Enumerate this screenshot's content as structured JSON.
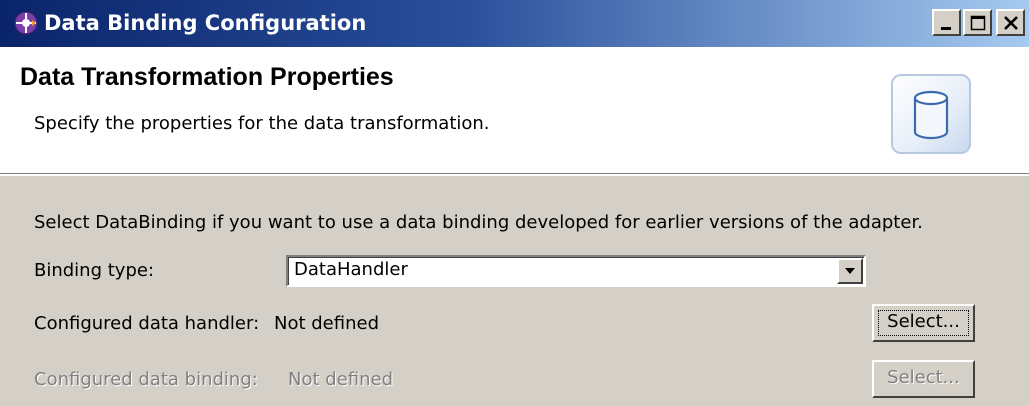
{
  "window": {
    "title": "Data Binding Configuration",
    "controls": {
      "minimize_icon": "minimize-icon",
      "maximize_icon": "maximize-icon",
      "close_icon": "close-icon"
    }
  },
  "header": {
    "title": "Data Transformation Properties",
    "description": "Specify the properties for the data transformation.",
    "icon": "database-cylinder-icon"
  },
  "content": {
    "info": "Select DataBinding if you want to use a data binding developed for earlier versions of the adapter.",
    "binding_type": {
      "label": "Binding type:",
      "value": "DataHandler"
    },
    "data_handler": {
      "label": "Configured data handler:",
      "value": "Not defined",
      "button": "Select..."
    },
    "data_binding": {
      "label": "Configured data binding:",
      "value": "Not defined",
      "button": "Select...",
      "disabled": true
    }
  },
  "colors": {
    "titlebar_start": "#0a246a",
    "titlebar_end": "#a6caf0",
    "dialog_bg": "#d4d0c8",
    "disabled_text": "#808080"
  }
}
